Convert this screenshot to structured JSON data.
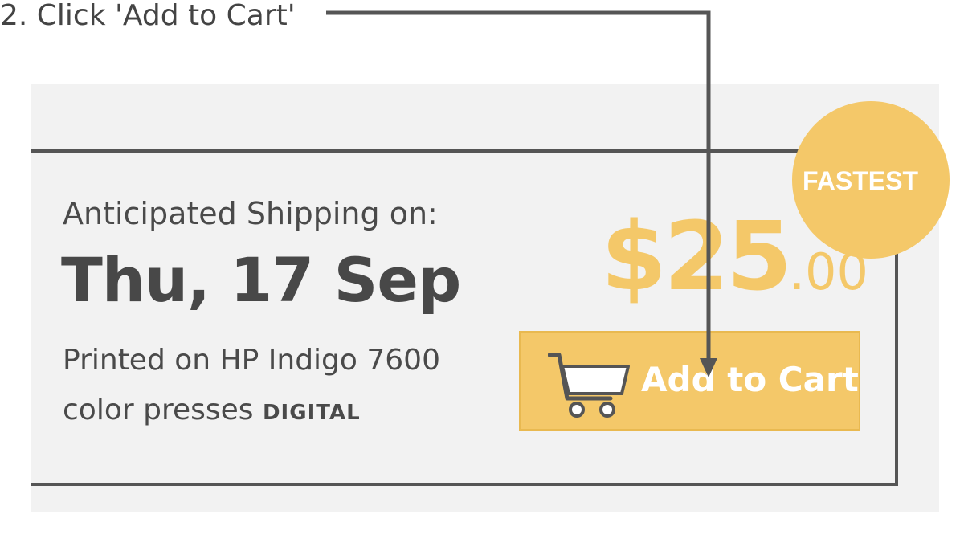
{
  "instruction": {
    "text": "2. Click 'Add to Cart'"
  },
  "shipping": {
    "label": "Anticipated Shipping on:",
    "date": "Thu, 17 Sep",
    "description": "Printed on HP Indigo 7600 color presses",
    "method_tag": "DIGITAL"
  },
  "price": {
    "dollars": "$25",
    "cents": ".00"
  },
  "badge": {
    "label": "FASTEST"
  },
  "cart_button": {
    "label": "Add to Cart",
    "icon": "shopping-cart-icon"
  },
  "colors": {
    "accent": "#f4c869",
    "text": "#4a4a4a",
    "panel": "#f2f2f2",
    "line": "#555555"
  }
}
